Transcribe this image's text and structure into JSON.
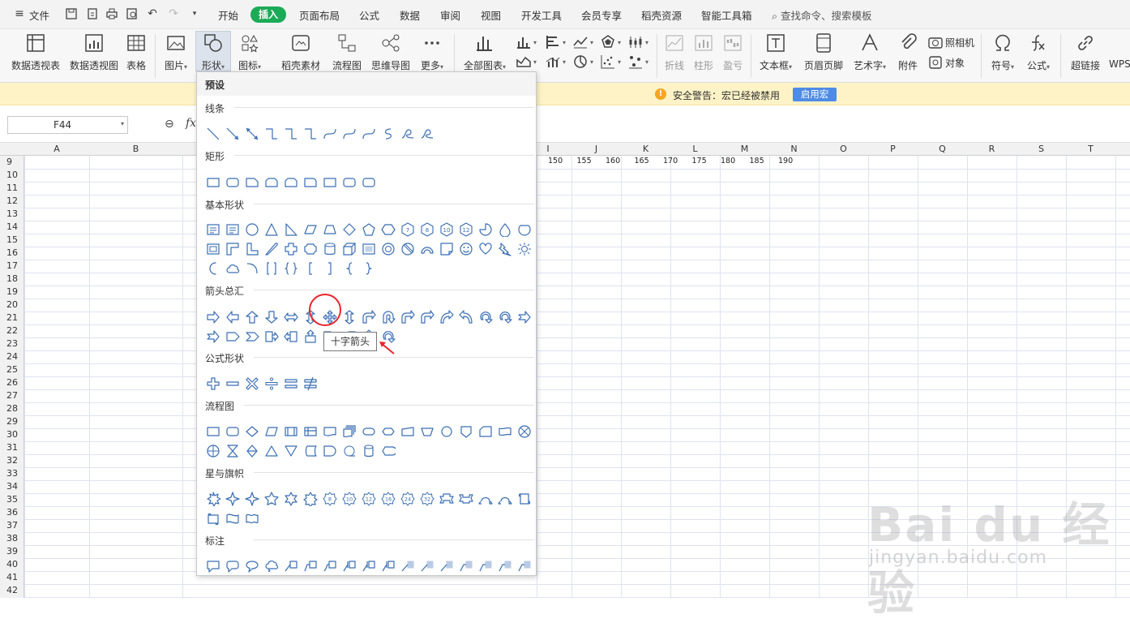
{
  "menubar": {
    "file": "文件",
    "tabs": [
      "开始",
      "插入",
      "页面布局",
      "公式",
      "数据",
      "审阅",
      "视图",
      "开发工具",
      "会员专享",
      "稻壳资源",
      "智能工具箱"
    ],
    "search_hint": "查找命令、搜索模板"
  },
  "ribbon": {
    "buttons": [
      "数据透视表",
      "数据透视图",
      "表格",
      "图片",
      "形状",
      "图标",
      "稻壳素材",
      "流程图",
      "思维导图",
      "更多",
      "全部图表",
      "折线",
      "柱形",
      "盈亏",
      "文本框",
      "页眉页脚",
      "艺术字",
      "附件",
      "照相机",
      "对象",
      "符号",
      "公式",
      "超链接",
      "WPS"
    ]
  },
  "security": {
    "text": "安全警告：宏已经被禁用",
    "button": "启用宏"
  },
  "formula_bar": {
    "name_box": "F44",
    "fx": "fx"
  },
  "sheet": {
    "columns": [
      "A",
      "B",
      "I",
      "J",
      "K",
      "L",
      "M",
      "N",
      "O",
      "P",
      "Q",
      "R",
      "S",
      "T"
    ],
    "rows": [
      "9",
      "10",
      "11",
      "12",
      "13",
      "14",
      "15",
      "16",
      "17",
      "18",
      "19",
      "20",
      "21",
      "22",
      "23",
      "24",
      "25",
      "26",
      "27",
      "28",
      "29",
      "30",
      "31",
      "32",
      "33",
      "34",
      "35",
      "36",
      "37",
      "38",
      "39",
      "40",
      "41",
      "42"
    ],
    "row9_values": [
      "150",
      "155",
      "160",
      "165",
      "170",
      "175",
      "180",
      "185",
      "190"
    ]
  },
  "dropdown": {
    "header": "预设",
    "sections": [
      "线条",
      "矩形",
      "基本形状",
      "箭头总汇",
      "公式形状",
      "流程图",
      "星与旗帜",
      "标注"
    ],
    "tooltip": "十字箭头"
  },
  "watermark": {
    "logo": "Bai du 经验",
    "url": "jingyan.baidu.com"
  },
  "colors": {
    "accent_green": "#1aab57",
    "shape_blue": "#3a6db3",
    "highlight_red": "#e8262b",
    "macro_button": "#4d8be6",
    "security_bg": "#fdf3c7"
  }
}
